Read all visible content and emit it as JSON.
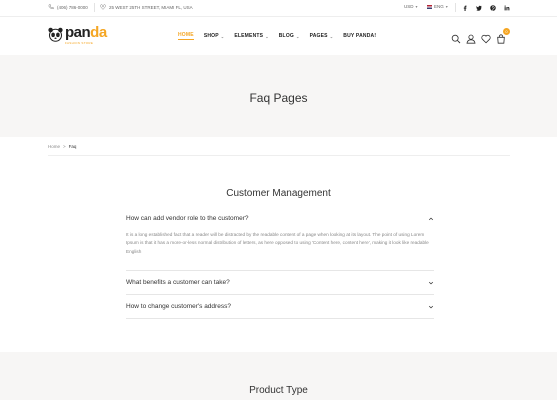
{
  "topbar": {
    "phone": "(406) 786-0000",
    "address": "25 WEST 25TH STREET, MIAMI FL, USA",
    "currency": "USD",
    "language": "ENG",
    "social_icons": [
      "facebook-icon",
      "twitter-icon",
      "pinterest-icon",
      "linkedin-icon"
    ]
  },
  "header": {
    "logo": {
      "part1": "pan",
      "part2": "da",
      "tagline": "FASHION STORE"
    },
    "nav": [
      {
        "label": "HOME",
        "active": true,
        "has_caret": false
      },
      {
        "label": "SHOP",
        "active": false,
        "has_caret": true
      },
      {
        "label": "ELEMENTS",
        "active": false,
        "has_caret": true
      },
      {
        "label": "BLOG",
        "active": false,
        "has_caret": true
      },
      {
        "label": "PAGES",
        "active": false,
        "has_caret": true
      },
      {
        "label": "BUY PANDA!",
        "active": false,
        "has_caret": false
      }
    ],
    "cart_count": "0"
  },
  "page": {
    "title": "Faq Pages"
  },
  "breadcrumb": {
    "home": "Home",
    "separator": ">",
    "current": "Faq"
  },
  "sections": [
    {
      "title": "Customer Management",
      "faqs": [
        {
          "question": "How can add vendor role to the customer?",
          "expanded": true,
          "answer": "It is a long established fact that a reader will be distracted by the readable content of a page when looking at its layout. The point of using Lorem Ipsum is that it has a more-or-less normal distribution of letters, as here opposed to using 'Content here, content here', making it look like readable English"
        },
        {
          "question": "What benefits a customer can take?",
          "expanded": false
        },
        {
          "question": "How to change customer's address?",
          "expanded": false
        }
      ]
    },
    {
      "title": "Product Type"
    }
  ],
  "colors": {
    "accent": "#f5a623",
    "band": "#f7f6f5",
    "text": "#333333"
  }
}
